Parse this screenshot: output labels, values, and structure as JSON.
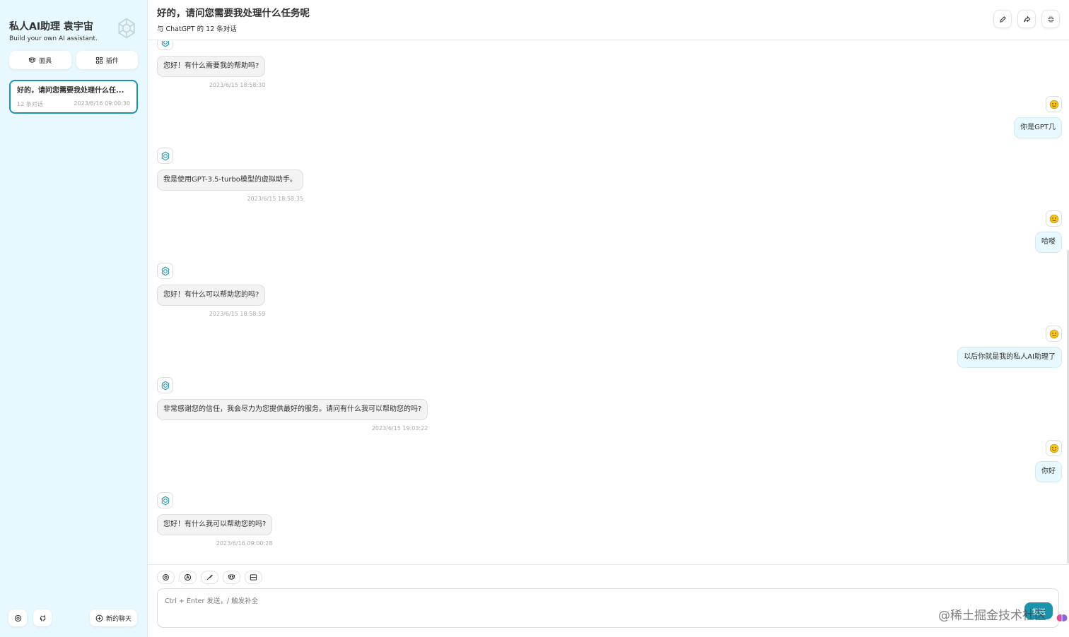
{
  "sidebar": {
    "title": "私人AI助理 袁宇宙",
    "subtitle": "Build your own AI assistant.",
    "tools": [
      {
        "label": "面具",
        "icon": "mask-icon"
      },
      {
        "label": "插件",
        "icon": "plugin-icon"
      }
    ],
    "chat": {
      "title": "好的，请问您需要我处理什么任...",
      "count": "12 条对话",
      "time": "2023/6/16 09:00:30"
    },
    "new_chat_label": "新的聊天"
  },
  "header": {
    "title": "好的，请问您需要我处理什么任务呢",
    "subtitle": "与 ChatGPT 的 12 条对话"
  },
  "messages": [
    {
      "role": "bot",
      "text": "您好！有什么需要我的帮助吗?",
      "time": "2023/6/15 18:58:30"
    },
    {
      "role": "user",
      "text": "你是GPT几"
    },
    {
      "role": "bot",
      "text": "我是使用GPT-3.5-turbo模型的虚拟助手。",
      "time": "2023/6/15 18:58:35"
    },
    {
      "role": "user",
      "text": "哈喽"
    },
    {
      "role": "bot",
      "text": "您好！有什么可以帮助您的吗?",
      "time": "2023/6/15 18:58:59"
    },
    {
      "role": "user",
      "text": "以后你就是我的私人AI助理了"
    },
    {
      "role": "bot",
      "text": "非常感谢您的信任，我会尽力为您提供最好的服务。请问有什么我可以帮助您的吗?",
      "time": "2023/6/15 19:03:22"
    },
    {
      "role": "user",
      "text": "你好"
    },
    {
      "role": "bot",
      "text": "您好！有什么我可以帮助您的吗?",
      "time": "2023/6/16 09:00:28"
    }
  ],
  "composer": {
    "placeholder": "Ctrl + Enter 发送，/ 触发补全",
    "send_label": "发送"
  },
  "watermark": "@稀土掘金技术社区",
  "colors": {
    "accent": "#1d93ab",
    "sidebar_bg": "#e7f8ff",
    "user_bubble": "#e7f8ff",
    "bot_bubble": "#f3f3f3"
  }
}
